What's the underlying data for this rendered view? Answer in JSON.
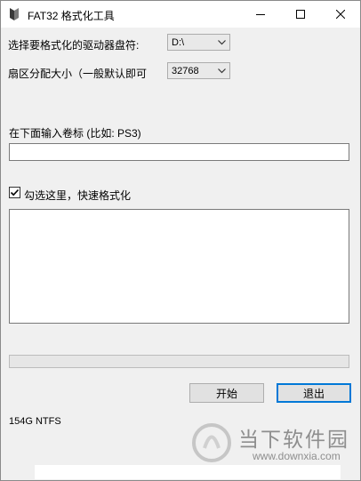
{
  "window": {
    "title": "FAT32 格式化工具"
  },
  "drive": {
    "label": "选择要格式化的驱动器盘符:",
    "value": "D:\\"
  },
  "sector": {
    "label": "扇区分配大小（一般默认即可",
    "value": "32768"
  },
  "volume": {
    "label": "在下面输入卷标 (比如: PS3)",
    "value": ""
  },
  "quick_format": {
    "label": "勾选这里，快速格式化",
    "checked": true
  },
  "progress": {
    "value": 0
  },
  "buttons": {
    "start": "开始",
    "exit": "退出"
  },
  "status": "154G NTFS",
  "watermark": {
    "title": "当下软件园",
    "url": "www.downxia.com"
  }
}
